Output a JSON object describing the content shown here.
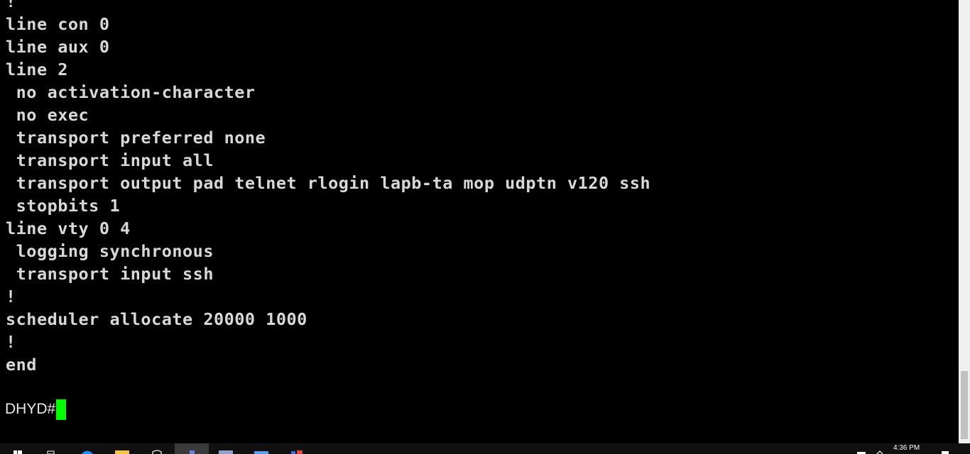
{
  "terminal": {
    "lines": [
      "!",
      "line con 0",
      "line aux 0",
      "line 2",
      " no activation-character",
      " no exec",
      " transport preferred none",
      " transport input all",
      " transport output pad telnet rlogin lapb-ta mop udptn v120 ssh",
      " stopbits 1",
      "line vty 0 4",
      " logging synchronous",
      " transport input ssh",
      "!",
      "scheduler allocate 20000 1000",
      "!",
      "end",
      ""
    ],
    "prompt": "DHYD#",
    "cursor_color": "#00ff00",
    "background": "#000000",
    "text_color": "#d8d8d8"
  },
  "taskbar": {
    "clock_time": "4:36 PM",
    "icons": [
      "windows-start-icon",
      "task-view-icon",
      "edge-browser-icon",
      "file-explorer-icon",
      "store-icon",
      "terminal-app-icon",
      "document-icon",
      "mail-icon",
      "network-app-icon"
    ],
    "tray_icons": [
      "notification-icon",
      "chevron-up-icon",
      "action-center-icon"
    ]
  }
}
